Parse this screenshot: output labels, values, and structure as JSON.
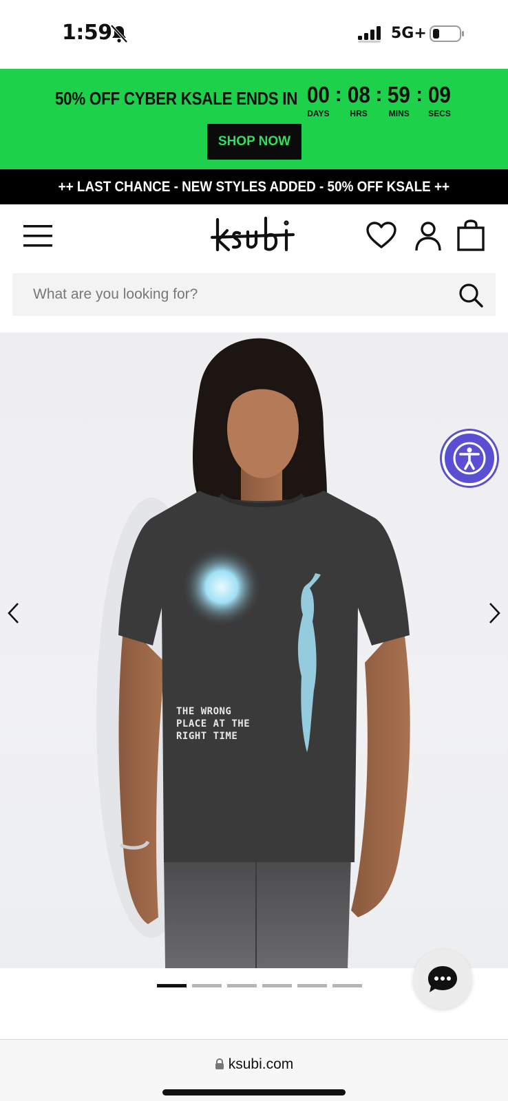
{
  "status_bar": {
    "time": "1:59",
    "network": "5G+",
    "icons": [
      "bell-off-icon",
      "signal-icon",
      "battery-icon"
    ]
  },
  "promo": {
    "text": "50% OFF CYBER KSALE ENDS IN",
    "countdown": [
      {
        "value": "00",
        "label": "DAYS"
      },
      {
        "value": "08",
        "label": "HRS"
      },
      {
        "value": "59",
        "label": "MINS"
      },
      {
        "value": "09",
        "label": "SECS"
      }
    ],
    "separator": ":",
    "cta": "SHOP NOW",
    "bg_color": "#1ed14a",
    "cta_text_color": "#2fe05a"
  },
  "ticker": {
    "text": "++ LAST CHANCE - NEW STYLES ADDED - 50% OFF KSALE ++"
  },
  "header": {
    "logo": "ksubi",
    "icons": [
      "menu-icon",
      "heart-icon",
      "user-icon",
      "bag-icon"
    ]
  },
  "search": {
    "placeholder": "What are you looking for?",
    "value": ""
  },
  "product": {
    "shirt_print": [
      "THE  WRONG",
      "PLACE AT THE",
      "RIGHT   TIME"
    ],
    "image_count": 6,
    "active_image": 1
  },
  "accessibility": {
    "icon": "accessibility-icon",
    "color": "#5a4ed2"
  },
  "chat": {
    "icon": "chat-icon"
  },
  "browser": {
    "url": "ksubi.com"
  }
}
